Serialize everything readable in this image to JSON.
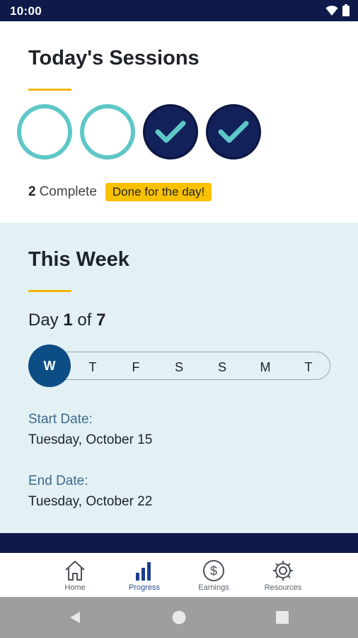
{
  "status_bar": {
    "time": "10:00"
  },
  "sessions": {
    "title": "Today's Sessions",
    "circles": [
      "empty",
      "empty",
      "complete",
      "complete"
    ],
    "complete_count": "2",
    "complete_label": "Complete",
    "badge": "Done for the day!"
  },
  "week": {
    "title": "This Week",
    "day_prefix": "Day",
    "day_current": "1",
    "day_of": "of",
    "day_total": "7",
    "days": [
      "W",
      "T",
      "F",
      "S",
      "S",
      "M",
      "T"
    ],
    "current_day_index": 0,
    "start_label": "Start Date:",
    "start_value": "Tuesday, October 15",
    "end_label": "End Date:",
    "end_value": "Tuesday, October 22"
  },
  "bottom_nav": {
    "items": [
      {
        "label": "Home",
        "icon": "home-icon"
      },
      {
        "label": "Progress",
        "icon": "bar-chart-icon",
        "active": true
      },
      {
        "label": "Earnings",
        "icon": "dollar-icon"
      },
      {
        "label": "Resources",
        "icon": "gear-icon"
      }
    ]
  },
  "colors": {
    "navy": "#0d1a4a",
    "teal_ring": "#5ec7c7",
    "accent_yellow": "#f9c100",
    "week_bg": "#e3f1f4",
    "active_day": "#0d4d86"
  }
}
